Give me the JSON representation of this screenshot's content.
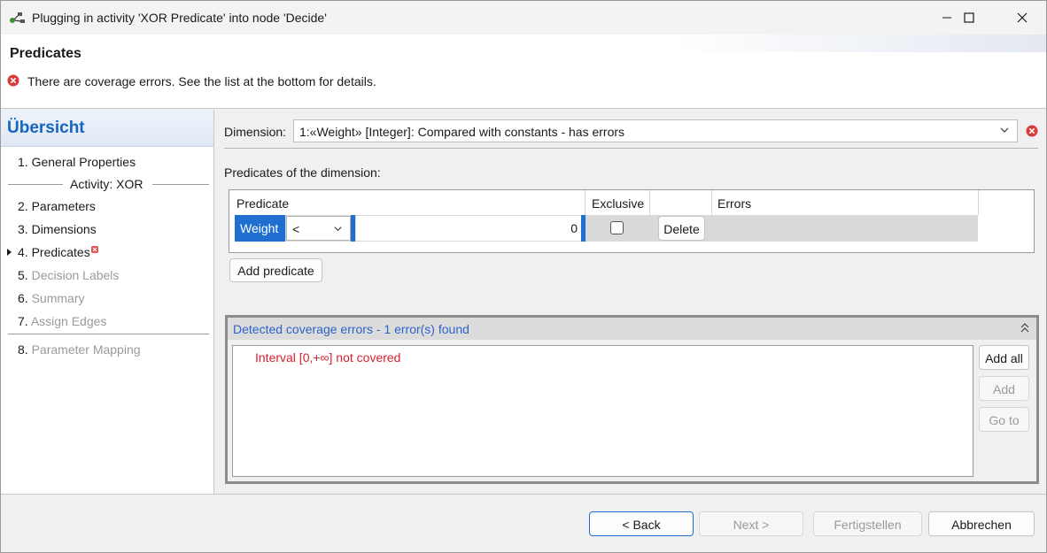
{
  "window": {
    "title": "Plugging in activity 'XOR Predicate' into node 'Decide'",
    "controls": [
      "minimize",
      "maximize",
      "close"
    ]
  },
  "header": {
    "title": "Predicates",
    "message": "There are coverage errors. See the list at the bottom for details."
  },
  "nav": {
    "title": "Übersicht",
    "items": [
      {
        "num": "1.",
        "label": "General Properties",
        "enabled": true
      },
      {
        "num": "2.",
        "label": "Parameters",
        "enabled": true
      },
      {
        "num": "3.",
        "label": "Dimensions",
        "enabled": true
      },
      {
        "num": "4.",
        "label": "Predicates",
        "enabled": true,
        "current": true,
        "has_error": true
      },
      {
        "num": "5.",
        "label": "Decision Labels",
        "enabled": false
      },
      {
        "num": "6.",
        "label": "Summary",
        "enabled": false
      },
      {
        "num": "7.",
        "label": "Assign Edges",
        "enabled": false
      },
      {
        "num": "8.",
        "label": "Parameter Mapping",
        "enabled": false
      }
    ],
    "group_label": "Activity: XOR"
  },
  "dimension": {
    "label": "Dimension:",
    "value": "1:«Weight» [Integer]: Compared with constants  -  has errors"
  },
  "predicates": {
    "label": "Predicates of the dimension:",
    "columns": [
      "Predicate",
      "Exclusive",
      "Errors"
    ],
    "rows": [
      {
        "name": "Weight",
        "operator": "<",
        "value": "0",
        "exclusive": false,
        "delete_label": "Delete",
        "errors": ""
      }
    ],
    "add_label": "Add predicate"
  },
  "coverage": {
    "title": "Detected coverage errors - 1 error(s) found",
    "errors": [
      "Interval [0,+∞] not covered"
    ],
    "add_all_label": "Add all",
    "add_label": "Add",
    "goto_label": "Go to"
  },
  "footer": {
    "back_label": "< Back",
    "next_label": "Next >",
    "finish_label": "Fertigstellen",
    "cancel_label": "Abbrechen"
  },
  "colors": {
    "accent": "#1e6fd0",
    "error_red": "#d6212e",
    "link_blue": "#2b63c7",
    "nav_title": "#1565c0"
  }
}
